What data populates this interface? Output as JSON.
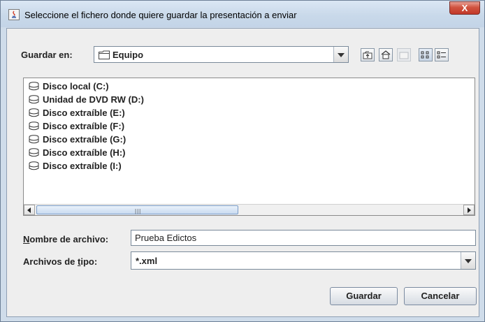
{
  "window": {
    "title": "Seleccione el fichero donde quiere guardar la presentación a enviar",
    "close_glyph": "X"
  },
  "look_in": {
    "label": "Guardar en:",
    "value": "Equipo",
    "icon": "folder-icon"
  },
  "toolbar": {
    "buttons": [
      {
        "name": "up-one-level-icon",
        "enabled": true
      },
      {
        "name": "home-icon",
        "enabled": true
      },
      {
        "name": "new-folder-icon",
        "enabled": false
      },
      {
        "name": "list-view-icon",
        "enabled": true,
        "selected": true
      },
      {
        "name": "details-view-icon",
        "enabled": true
      }
    ]
  },
  "files": [
    {
      "label": "Disco local (C:)",
      "icon": "drive-icon"
    },
    {
      "label": "Unidad de DVD RW (D:)",
      "icon": "drive-icon"
    },
    {
      "label": "Disco extraíble (E:)",
      "icon": "drive-icon"
    },
    {
      "label": "Disco extraíble (F:)",
      "icon": "drive-icon"
    },
    {
      "label": "Disco extraíble (G:)",
      "icon": "drive-icon"
    },
    {
      "label": "Disco extraíble (H:)",
      "icon": "drive-icon"
    },
    {
      "label": "Disco extraíble (I:)",
      "icon": "drive-icon"
    }
  ],
  "filename": {
    "label_mnemonic": "N",
    "label_rest": "ombre de archivo:",
    "value": "Prueba Edictos"
  },
  "filetype": {
    "label_before": "Archivos de ",
    "label_mnemonic": "t",
    "label_after": "ipo:",
    "value": "*.xml"
  },
  "buttons": {
    "save": "Guardar",
    "cancel": "Cancelar"
  },
  "colors": {
    "title_bar": "#c9d9ea",
    "close_button": "#c2392a",
    "dialog_bg": "#eeeeee",
    "scroll_thumb": "#c8daf0"
  }
}
